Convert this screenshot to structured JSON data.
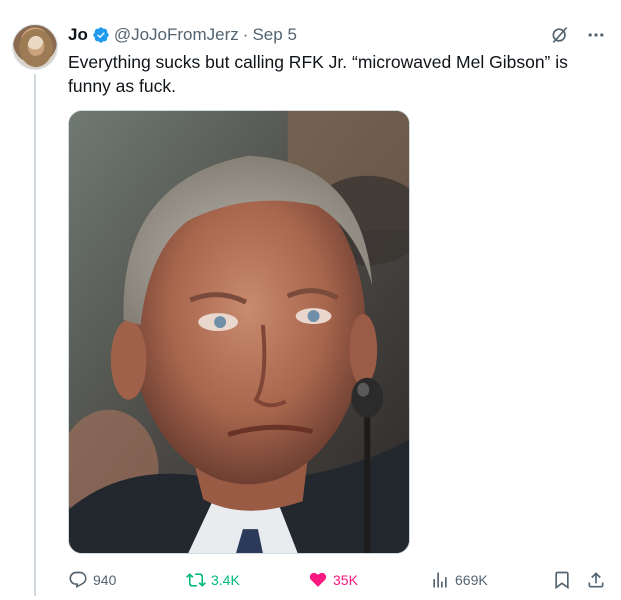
{
  "author": {
    "name": "Jo",
    "handle": "@JoJoFromJerz",
    "separator": "·",
    "date": "Sep 5",
    "verified": true
  },
  "tweet": {
    "text_line_1": "Everything sucks but calling RFK Jr. “microwaved Mel Gibson” is",
    "text_line_2": "funny as fuck."
  },
  "media": {
    "alt": "photo"
  },
  "metrics": {
    "replies": "940",
    "retweets": "3.4K",
    "likes": "35K",
    "views": "669K"
  },
  "colors": {
    "retweeted": "#00ba7c",
    "liked": "#f91880",
    "muted": "#536471",
    "verified": "#1d9bf0"
  },
  "icons": [
    "verified-badge-icon",
    "grok-icon",
    "more-icon",
    "reply-icon",
    "retweet-icon",
    "like-icon",
    "views-icon",
    "bookmark-icon",
    "share-icon"
  ]
}
